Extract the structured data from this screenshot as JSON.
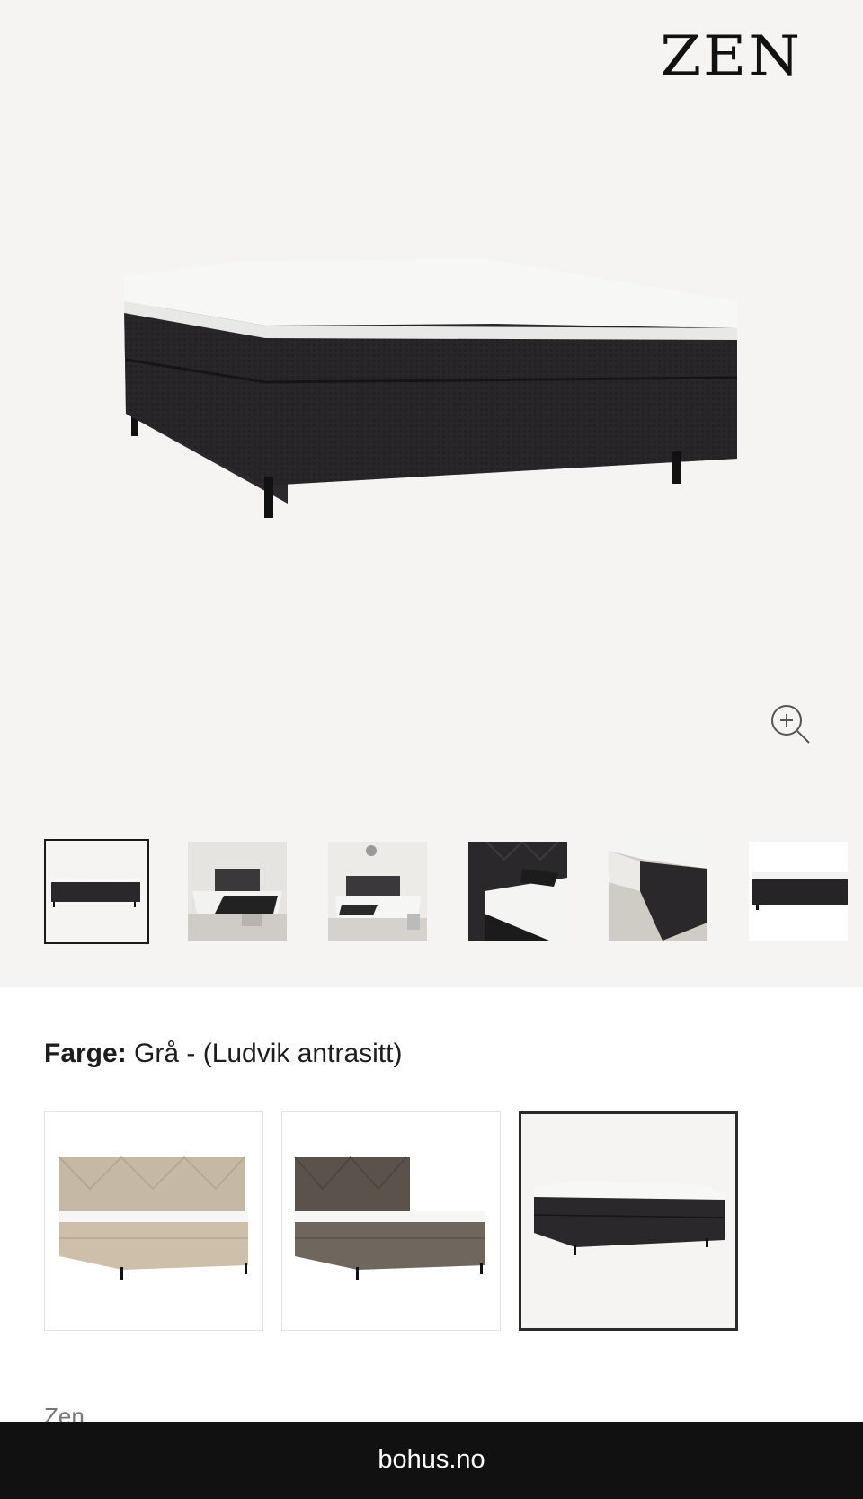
{
  "brand": {
    "logo": "ZEN"
  },
  "gallery": {
    "zoom_icon": "zoom-in-icon",
    "thumbnails": [
      {
        "name": "product-front",
        "selected": true
      },
      {
        "name": "bedroom-scene-1",
        "selected": false
      },
      {
        "name": "bedroom-scene-2",
        "selected": false
      },
      {
        "name": "headboard-detail",
        "selected": false
      },
      {
        "name": "corner-detail",
        "selected": false
      },
      {
        "name": "product-side",
        "selected": false
      }
    ]
  },
  "color": {
    "label": "Farge:",
    "value": "Grå - (Ludvik antrasitt)",
    "options": [
      {
        "name": "beige",
        "selected": false
      },
      {
        "name": "brown-grey",
        "selected": false
      },
      {
        "name": "anthracite",
        "selected": true
      }
    ]
  },
  "product": {
    "brand_name": "Zen"
  },
  "footer": {
    "domain": "bohus.no"
  },
  "colors": {
    "hero_bg": "#f5f4f2",
    "fabric_dark": "#262426",
    "mattress": "#f7f7f5",
    "footer_bg": "#111111"
  }
}
